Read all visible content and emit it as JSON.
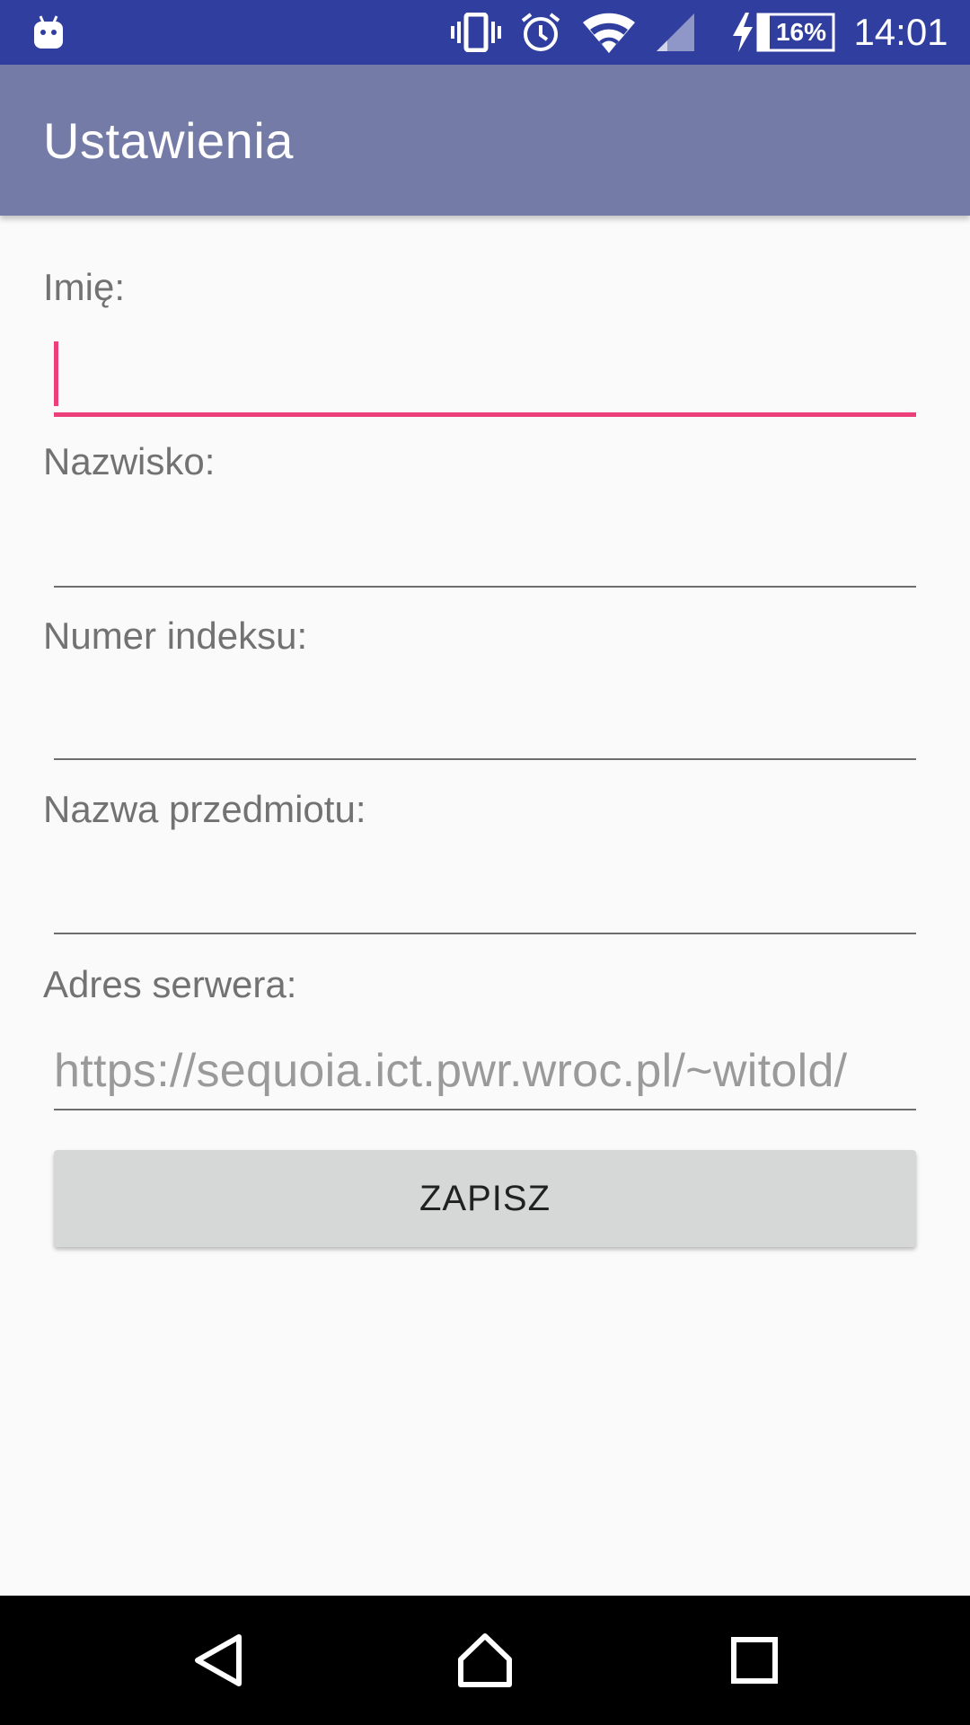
{
  "status_bar": {
    "time": "14:01",
    "battery_percent": "16%",
    "icons": [
      "android-notification-icon",
      "vibrate-icon",
      "alarm-icon",
      "wifi-icon",
      "cell-signal-icon",
      "charging-icon",
      "battery-icon"
    ]
  },
  "app_bar": {
    "title": "Ustawienia",
    "color": "#737ba6"
  },
  "form": {
    "first_name": {
      "label": "Imię:",
      "value": ""
    },
    "last_name": {
      "label": "Nazwisko:",
      "value": ""
    },
    "index_number": {
      "label": "Numer indeksu:",
      "value": ""
    },
    "subject_name": {
      "label": "Nazwa przedmiotu:",
      "value": ""
    },
    "server_address": {
      "label": "Adres serwera:",
      "value": "https://sequoia.ict.pwr.wroc.pl/~witold/"
    },
    "save_label": "ZAPISZ",
    "accent_color": "#ec407a"
  },
  "nav_bar": {
    "icons": [
      "back-icon",
      "home-icon",
      "recents-icon"
    ]
  }
}
